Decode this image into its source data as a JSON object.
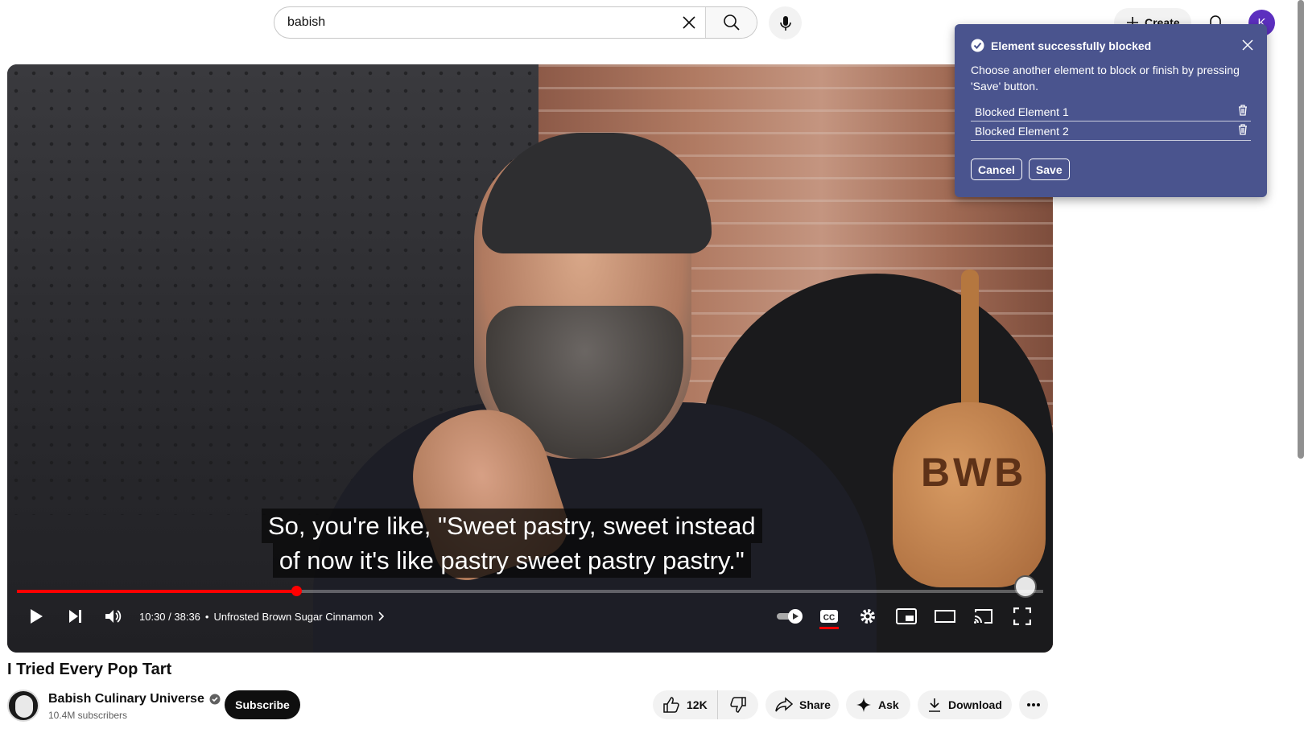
{
  "search": {
    "value": "babish"
  },
  "header": {
    "create_label": "Create",
    "avatar_letter": "K"
  },
  "player": {
    "caption_lines": [
      "So, you're like, \"Sweet pastry, sweet instead",
      "of now it's like pastry sweet pastry pastry.\""
    ],
    "peel_text": "BWB",
    "time_display": "10:30 / 38:36",
    "chapter_separator": "•",
    "chapter_title": "Unfrosted Brown Sugar Cinnamon",
    "progress_fraction": 0.272,
    "buffer_fraction": 0.26
  },
  "video": {
    "title": "I Tried Every Pop Tart",
    "channel_name": "Babish Culinary Universe",
    "subscribers": "10.4M subscribers",
    "subscribe_label": "Subscribe",
    "like_count": "12K",
    "share_label": "Share",
    "ask_label": "Ask",
    "download_label": "Download"
  },
  "popup": {
    "title": "Element successfully blocked",
    "description": "Choose another element to block or finish by pressing 'Save' button.",
    "blocked_items": [
      "Blocked Element 1",
      "Blocked Element 2"
    ],
    "cancel_label": "Cancel",
    "save_label": "Save"
  },
  "colors": {
    "popup_bg": "#4a548e",
    "progress": "#ff0000",
    "subscribe_bg": "#0f0f0f",
    "avatar_bg": "#5c2fbf"
  },
  "icons": [
    "close-icon",
    "search-icon",
    "mic-icon",
    "plus-icon",
    "bell-icon",
    "play-icon",
    "next-icon",
    "volume-icon",
    "autoplay-toggle-icon",
    "cc-icon",
    "settings-icon",
    "miniplayer-icon",
    "theater-icon",
    "cast-icon",
    "fullscreen-icon",
    "check-circle-icon",
    "trash-icon",
    "like-icon",
    "dislike-icon",
    "share-icon",
    "sparkle-icon",
    "download-icon",
    "more-icon",
    "verified-icon"
  ]
}
